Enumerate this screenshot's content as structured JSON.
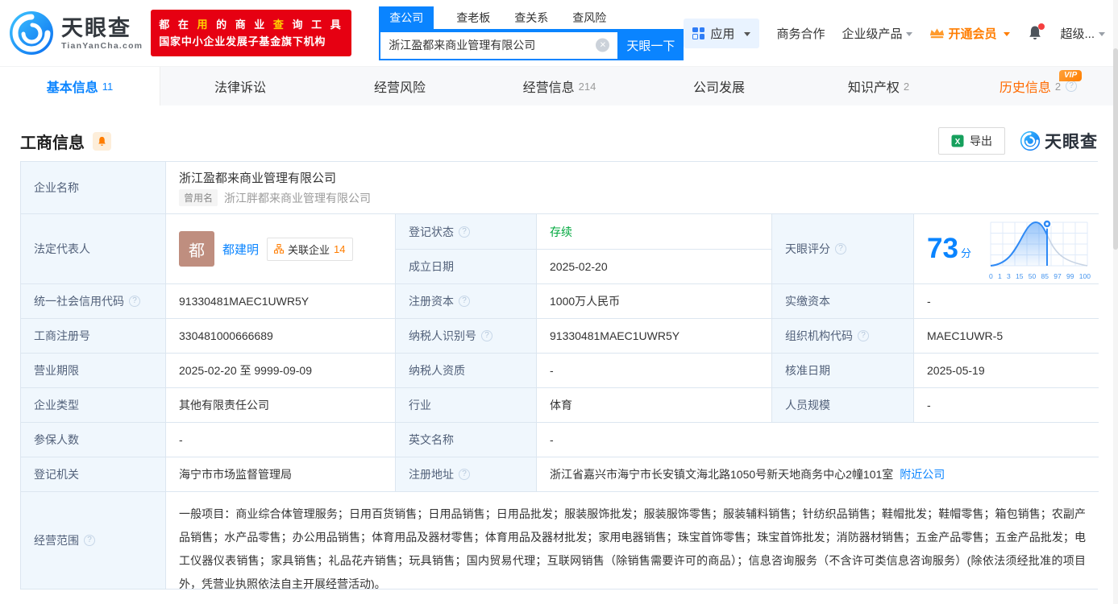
{
  "brand": {
    "name": "天眼查",
    "domain": "TianYanCha.com",
    "slogan": [
      "都 在 ",
      "用",
      " 的 商 业 ",
      "查",
      " 询 工 具"
    ],
    "slogan_line2": "国家中小企业发展子基金旗下机构"
  },
  "search": {
    "tabs": [
      {
        "label": "查公司"
      },
      {
        "label": "查老板"
      },
      {
        "label": "查关系"
      },
      {
        "label": "查风险"
      }
    ],
    "value": "浙江盈都来商业管理有限公司",
    "button_label": "天眼一下"
  },
  "topnav": {
    "apps_label": "应用",
    "cooperation_label": "商务合作",
    "enterprise_label": "企业级产品",
    "vip_label": "开通会员",
    "user_label": "超级..."
  },
  "page_tabs": [
    {
      "label": "基本信息",
      "count": "11"
    },
    {
      "label": "法律诉讼"
    },
    {
      "label": "经营风险"
    },
    {
      "label": "经营信息",
      "count": "214"
    },
    {
      "label": "公司发展"
    },
    {
      "label": "知识产权",
      "count": "2"
    },
    {
      "label": "历史信息",
      "count": "2",
      "vip_badge": "VIP"
    }
  ],
  "section": {
    "title": "工商信息",
    "export_label": "导出",
    "logo_text": "天眼查"
  },
  "table": {
    "company_name": {
      "label": "企业名称",
      "value": "浙江盈都来商业管理有限公司",
      "former_label": "曾用名",
      "former_value": "浙江胖都来商业管理有限公司"
    },
    "legal_rep": {
      "label": "法定代表人",
      "avatar_char": "都",
      "name": "都建明",
      "related_label": "关联企业",
      "related_count": "14"
    },
    "reg_status": {
      "label": "登记状态",
      "value": "存续"
    },
    "establish_date": {
      "label": "成立日期",
      "value": "2025-02-20"
    },
    "score": {
      "label": "天眼评分",
      "value": "73",
      "unit": "分",
      "ticks": [
        "0",
        "1",
        "3",
        "15",
        "50",
        "85",
        "97",
        "99",
        "100"
      ]
    },
    "credit_code": {
      "label": "统一社会信用代码",
      "value": "91330481MAEC1UWR5Y"
    },
    "reg_capital": {
      "label": "注册资本",
      "value": "1000万人民币"
    },
    "paid_capital": {
      "label": "实缴资本",
      "value": "-"
    },
    "reg_number": {
      "label": "工商注册号",
      "value": "330481000666689"
    },
    "taxpayer_id": {
      "label": "纳税人识别号",
      "value": "91330481MAEC1UWR5Y"
    },
    "org_code": {
      "label": "组织机构代码",
      "value": "MAEC1UWR-5"
    },
    "business_term": {
      "label": "营业期限",
      "value": "2025-02-20 至 9999-09-09"
    },
    "taxpayer_quality": {
      "label": "纳税人资质",
      "value": "-"
    },
    "approved_date": {
      "label": "核准日期",
      "value": "2025-05-19"
    },
    "company_type": {
      "label": "企业类型",
      "value": "其他有限责任公司"
    },
    "industry": {
      "label": "行业",
      "value": "体育"
    },
    "staff_size": {
      "label": "人员规模",
      "value": "-"
    },
    "insured_count": {
      "label": "参保人数",
      "value": "-"
    },
    "english_name": {
      "label": "英文名称",
      "value": "-"
    },
    "reg_authority": {
      "label": "登记机关",
      "value": "海宁市市场监督管理局"
    },
    "reg_address": {
      "label": "注册地址",
      "value": "浙江省嘉兴市海宁市长安镇文海北路1050号新天地商务中心2幢101室",
      "nearby_label": "附近公司"
    },
    "business_scope": {
      "label": "经营范围",
      "value": "一般项目：商业综合体管理服务；日用百货销售；日用品销售；日用品批发；服装服饰批发；服装服饰零售；服装辅料销售；针纺织品销售；鞋帽批发；鞋帽零售；箱包销售；农副产品销售；水产品零售；办公用品销售；体育用品及器材零售；体育用品及器材批发；家用电器销售；珠宝首饰零售；珠宝首饰批发；消防器材销售；五金产品零售；五金产品批发；电工仪器仪表销售；家具销售；礼品花卉销售；玩具销售；国内贸易代理；互联网销售（除销售需要许可的商品）；信息咨询服务（不含许可类信息咨询服务）(除依法须经批准的项目外，凭营业执照依法自主开展经营活动)。"
    }
  }
}
